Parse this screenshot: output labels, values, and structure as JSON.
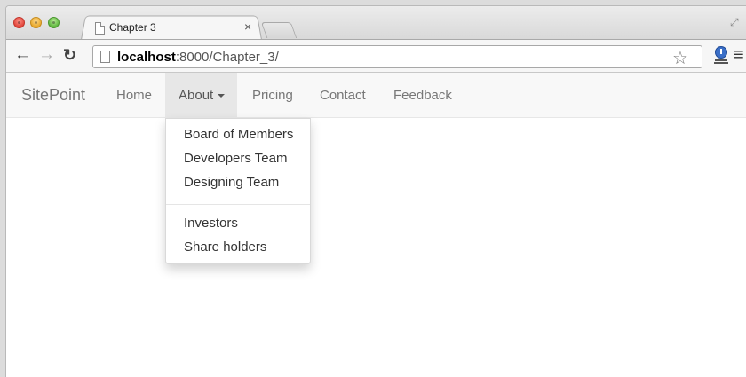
{
  "browser": {
    "tab": {
      "title": "Chapter 3",
      "close_label": "×"
    },
    "url": {
      "host": "localhost",
      "rest": ":8000/Chapter_3/"
    },
    "icons": {
      "back": "back-arrow-icon",
      "forward": "forward-arrow-icon",
      "reload": "reload-icon",
      "star": "star-icon",
      "menu": "menu-icon"
    }
  },
  "navbar": {
    "brand": "SitePoint",
    "links": [
      {
        "label": "Home"
      },
      {
        "label": "About"
      },
      {
        "label": "Pricing"
      },
      {
        "label": "Contact"
      },
      {
        "label": "Feedback"
      }
    ]
  },
  "dropdown": {
    "group1": [
      "Board of Members",
      "Developers Team",
      "Designing Team"
    ],
    "group2": [
      "Investors",
      "Share holders"
    ]
  },
  "colors": {
    "navbar_bg": "#f8f8f8",
    "active_bg": "#e7e7e7",
    "link_text": "#777777"
  }
}
